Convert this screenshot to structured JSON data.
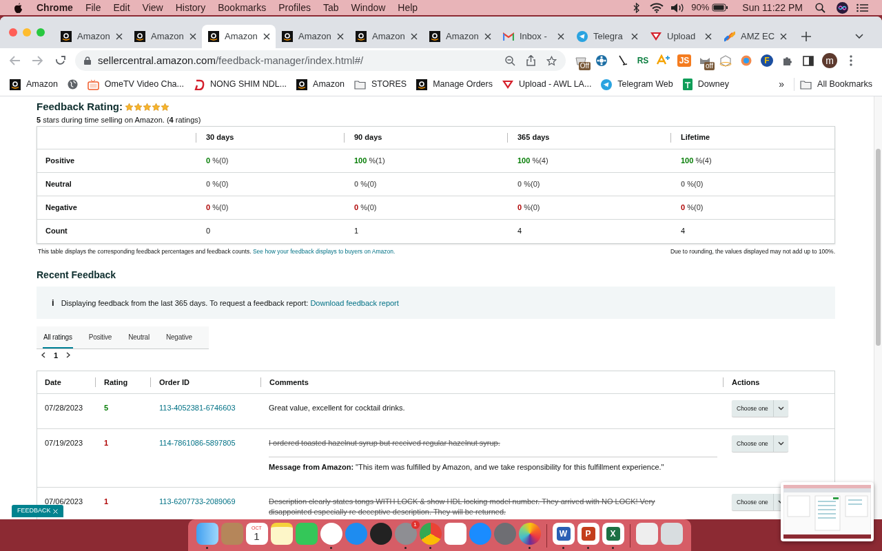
{
  "menubar": {
    "app": "Chrome",
    "items": [
      "File",
      "Edit",
      "View",
      "History",
      "Bookmarks",
      "Profiles",
      "Tab",
      "Window",
      "Help"
    ],
    "battery": "90%",
    "clock": "Sun 11:22 PM"
  },
  "tabs": [
    {
      "title": "Amazon",
      "kind": "amazon",
      "selected": false
    },
    {
      "title": "Amazon",
      "kind": "amazon",
      "selected": false
    },
    {
      "title": "Amazon",
      "kind": "amazon",
      "selected": true
    },
    {
      "title": "Amazon",
      "kind": "amazon",
      "selected": false
    },
    {
      "title": "Amazon",
      "kind": "amazon",
      "selected": false
    },
    {
      "title": "Amazon",
      "kind": "amazon",
      "selected": false
    },
    {
      "title": "Inbox -",
      "kind": "gmail",
      "selected": false
    },
    {
      "title": "Telegra",
      "kind": "telegram",
      "selected": false
    },
    {
      "title": "Upload",
      "kind": "upload",
      "selected": false
    },
    {
      "title": "AMZ EC",
      "kind": "amz",
      "selected": false
    }
  ],
  "address": {
    "host": "sellercentral.amazon.com",
    "path": "/feedback-manager/index.html#/"
  },
  "extensions": [
    {
      "kind": "bucket",
      "badge": "Off"
    },
    {
      "kind": "wheel"
    },
    {
      "kind": "broom"
    },
    {
      "kind": "letters",
      "label": "RS"
    },
    {
      "kind": "scout"
    },
    {
      "kind": "tile",
      "label": "JS"
    },
    {
      "kind": "cat",
      "badge": "off"
    },
    {
      "kind": "cube"
    },
    {
      "kind": "ring"
    },
    {
      "kind": "hex",
      "label": "F"
    },
    {
      "kind": "puzzle"
    },
    {
      "kind": "sidepanel"
    }
  ],
  "avatar": "m",
  "bookmarks": [
    {
      "kind": "amazon",
      "label": "Amazon"
    },
    {
      "kind": "globe"
    },
    {
      "kind": "tv",
      "label": "OmeTV Video Cha..."
    },
    {
      "kind": "d",
      "label": "NONG SHIM NDL..."
    },
    {
      "kind": "amazon",
      "label": "Amazon"
    },
    {
      "kind": "folder",
      "label": "STORES"
    },
    {
      "kind": "amazon",
      "label": "Manage Orders"
    },
    {
      "kind": "upload",
      "label": "Upload - AWL LA..."
    },
    {
      "kind": "telegram",
      "label": "Telegram Web"
    },
    {
      "kind": "sheets",
      "label": "Downey"
    }
  ],
  "bookmarks_more": "»",
  "all_bookmarks": "All Bookmarks",
  "rating": {
    "title": "Feedback Rating:",
    "stars": 5,
    "summary": "**5** stars during time selling on Amazon. (**4** ratings)"
  },
  "summary_table": {
    "columns": [
      "30 days",
      "90 days",
      "365 days",
      "Lifetime"
    ],
    "rows": [
      {
        "label": "Positive",
        "kind": "positive",
        "cells": [
          {
            "value": "0",
            "count": "%(0)"
          },
          {
            "value": "100",
            "count": "%(1)"
          },
          {
            "value": "100",
            "count": "%(4)"
          },
          {
            "value": "100",
            "count": "%(4)"
          }
        ]
      },
      {
        "label": "Neutral",
        "kind": "neutral",
        "cells": [
          {
            "value": "0",
            "count": "%(0)"
          },
          {
            "value": "0",
            "count": "%(0)"
          },
          {
            "value": "0",
            "count": "%(0)"
          },
          {
            "value": "0",
            "count": "%(0)"
          }
        ]
      },
      {
        "label": "Negative",
        "kind": "negative",
        "cells": [
          {
            "value": "0",
            "count": "%(0)"
          },
          {
            "value": "0",
            "count": "%(0)"
          },
          {
            "value": "0",
            "count": "%(0)"
          },
          {
            "value": "0",
            "count": "%(0)"
          }
        ]
      },
      {
        "label": "Count",
        "kind": "count",
        "cells": [
          {
            "value": "0"
          },
          {
            "value": "1"
          },
          {
            "value": "4"
          },
          {
            "value": "4"
          }
        ]
      }
    ],
    "note": "This table displays the corresponding feedback percentages and feedback counts.",
    "note_link": "See how your feedback displays to buyers on Amazon.",
    "rounding_note": "Due to rounding, the values displayed may not add up to 100%."
  },
  "recent": {
    "title": "Recent Feedback",
    "info_icon": "i",
    "info": "Displaying feedback from the last 365 days. To request a feedback report:",
    "info_link": "Download feedback report",
    "filters": [
      {
        "label": "All ratings",
        "selected": true
      },
      {
        "label": "Positive",
        "selected": false
      },
      {
        "label": "Neutral",
        "selected": false
      },
      {
        "label": "Negative",
        "selected": false
      }
    ],
    "page": "1",
    "columns": [
      "Date",
      "Rating",
      "Order ID",
      "Comments",
      "Actions"
    ],
    "rows": [
      {
        "date": "07/28/2023",
        "rating": "5",
        "kind": "positive",
        "order": "113-4052381-6746603",
        "comment": "Great value, excellent for cocktail drinks.",
        "struck": false,
        "action": "Choose one"
      },
      {
        "date": "07/19/2023",
        "rating": "1",
        "kind": "negative",
        "order": "114-7861086-5897805",
        "comment": "I ordered toasted hazelnut syrup but received regular hazelnut syrup.",
        "struck": true,
        "message": "**Message from Amazon:** \"This item was fulfilled by Amazon, and we take responsibility for this fulfillment experience.\"",
        "action": "Choose one"
      },
      {
        "date": "07/06/2023",
        "rating": "1",
        "kind": "negative",
        "order": "113-6207733-2089069",
        "comment": "Description clearly states tongs WITH LOCK & show HDL locking model number. They arrived with NO LOCK! Very disappointed especially re deceptive description. They will be returned.",
        "struck": true,
        "action": "Choose one"
      }
    ]
  },
  "feedback_button": "FEEDBACK",
  "dock": [
    {
      "kind": "finder",
      "running": true
    },
    {
      "kind": "contacts",
      "running": false
    },
    {
      "kind": "calendar",
      "month": "OCT",
      "day": "1",
      "running": false
    },
    {
      "kind": "notes",
      "running": false
    },
    {
      "kind": "facetime",
      "running": false
    },
    {
      "kind": "music",
      "running": true
    },
    {
      "kind": "appstore",
      "running": false
    },
    {
      "kind": "siri",
      "running": false
    },
    {
      "kind": "settings",
      "badge": "1",
      "running": true
    },
    {
      "kind": "chrome",
      "running": true
    },
    {
      "kind": "reminders",
      "running": false
    },
    {
      "kind": "safari",
      "running": false
    },
    {
      "kind": "rocket",
      "running": false
    },
    {
      "kind": "photos",
      "running": true
    },
    {
      "kind": "separator"
    },
    {
      "kind": "office",
      "label": "W",
      "color": "#2b5fb4",
      "running": true
    },
    {
      "kind": "office",
      "label": "P",
      "color": "#c43e1c",
      "running": true
    },
    {
      "kind": "office",
      "label": "X",
      "color": "#1d7044",
      "running": true
    },
    {
      "kind": "separator"
    },
    {
      "kind": "document",
      "running": false
    },
    {
      "kind": "trash",
      "running": false
    }
  ]
}
